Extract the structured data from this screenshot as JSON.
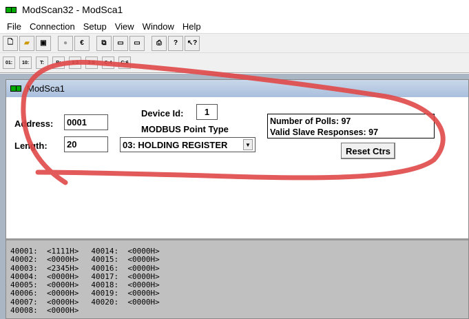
{
  "app": {
    "title": "ModScan32 - ModSca1"
  },
  "menu": [
    "File",
    "Connection",
    "Setup",
    "View",
    "Window",
    "Help"
  ],
  "toolbar1": [
    "new",
    "open",
    "save",
    "stop",
    "connect",
    "tile",
    "display",
    "monitor",
    "print",
    "help",
    "context-help"
  ],
  "toolbar2": [
    "01:",
    "10:",
    "T:",
    "R:",
    "3:3",
    "3:E",
    "C:4",
    "C:6"
  ],
  "child": {
    "title": "ModSca1",
    "address_label": "Address:",
    "address": "0001",
    "length_label": "Length:",
    "length": "20",
    "device_id_label": "Device Id:",
    "device_id": "1",
    "point_type_label": "MODBUS Point Type",
    "point_type": "03: HOLDING REGISTER",
    "polls": "Number of Polls: 97",
    "responses": "Valid Slave Responses: 97",
    "reset_label": "Reset Ctrs"
  },
  "registers": [
    [
      "40001:",
      "<1111H>"
    ],
    [
      "40002:",
      "<0000H>"
    ],
    [
      "40003:",
      "<2345H>"
    ],
    [
      "40004:",
      "<0000H>"
    ],
    [
      "40005:",
      "<0000H>"
    ],
    [
      "40006:",
      "<0000H>"
    ],
    [
      "40007:",
      "<0000H>"
    ],
    [
      "40008:",
      "<0000H>"
    ],
    [
      "40014:",
      "<0000H>"
    ],
    [
      "40015:",
      "<0000H>"
    ],
    [
      "40016:",
      "<0000H>"
    ],
    [
      "40017:",
      "<0000H>"
    ],
    [
      "40018:",
      "<0000H>"
    ],
    [
      "40019:",
      "<0000H>"
    ],
    [
      "40020:",
      "<0000H>"
    ]
  ],
  "colors": {
    "annotation": "#e04848",
    "client_bg": "#abb6c4",
    "data_bg": "#c0c0c0"
  }
}
